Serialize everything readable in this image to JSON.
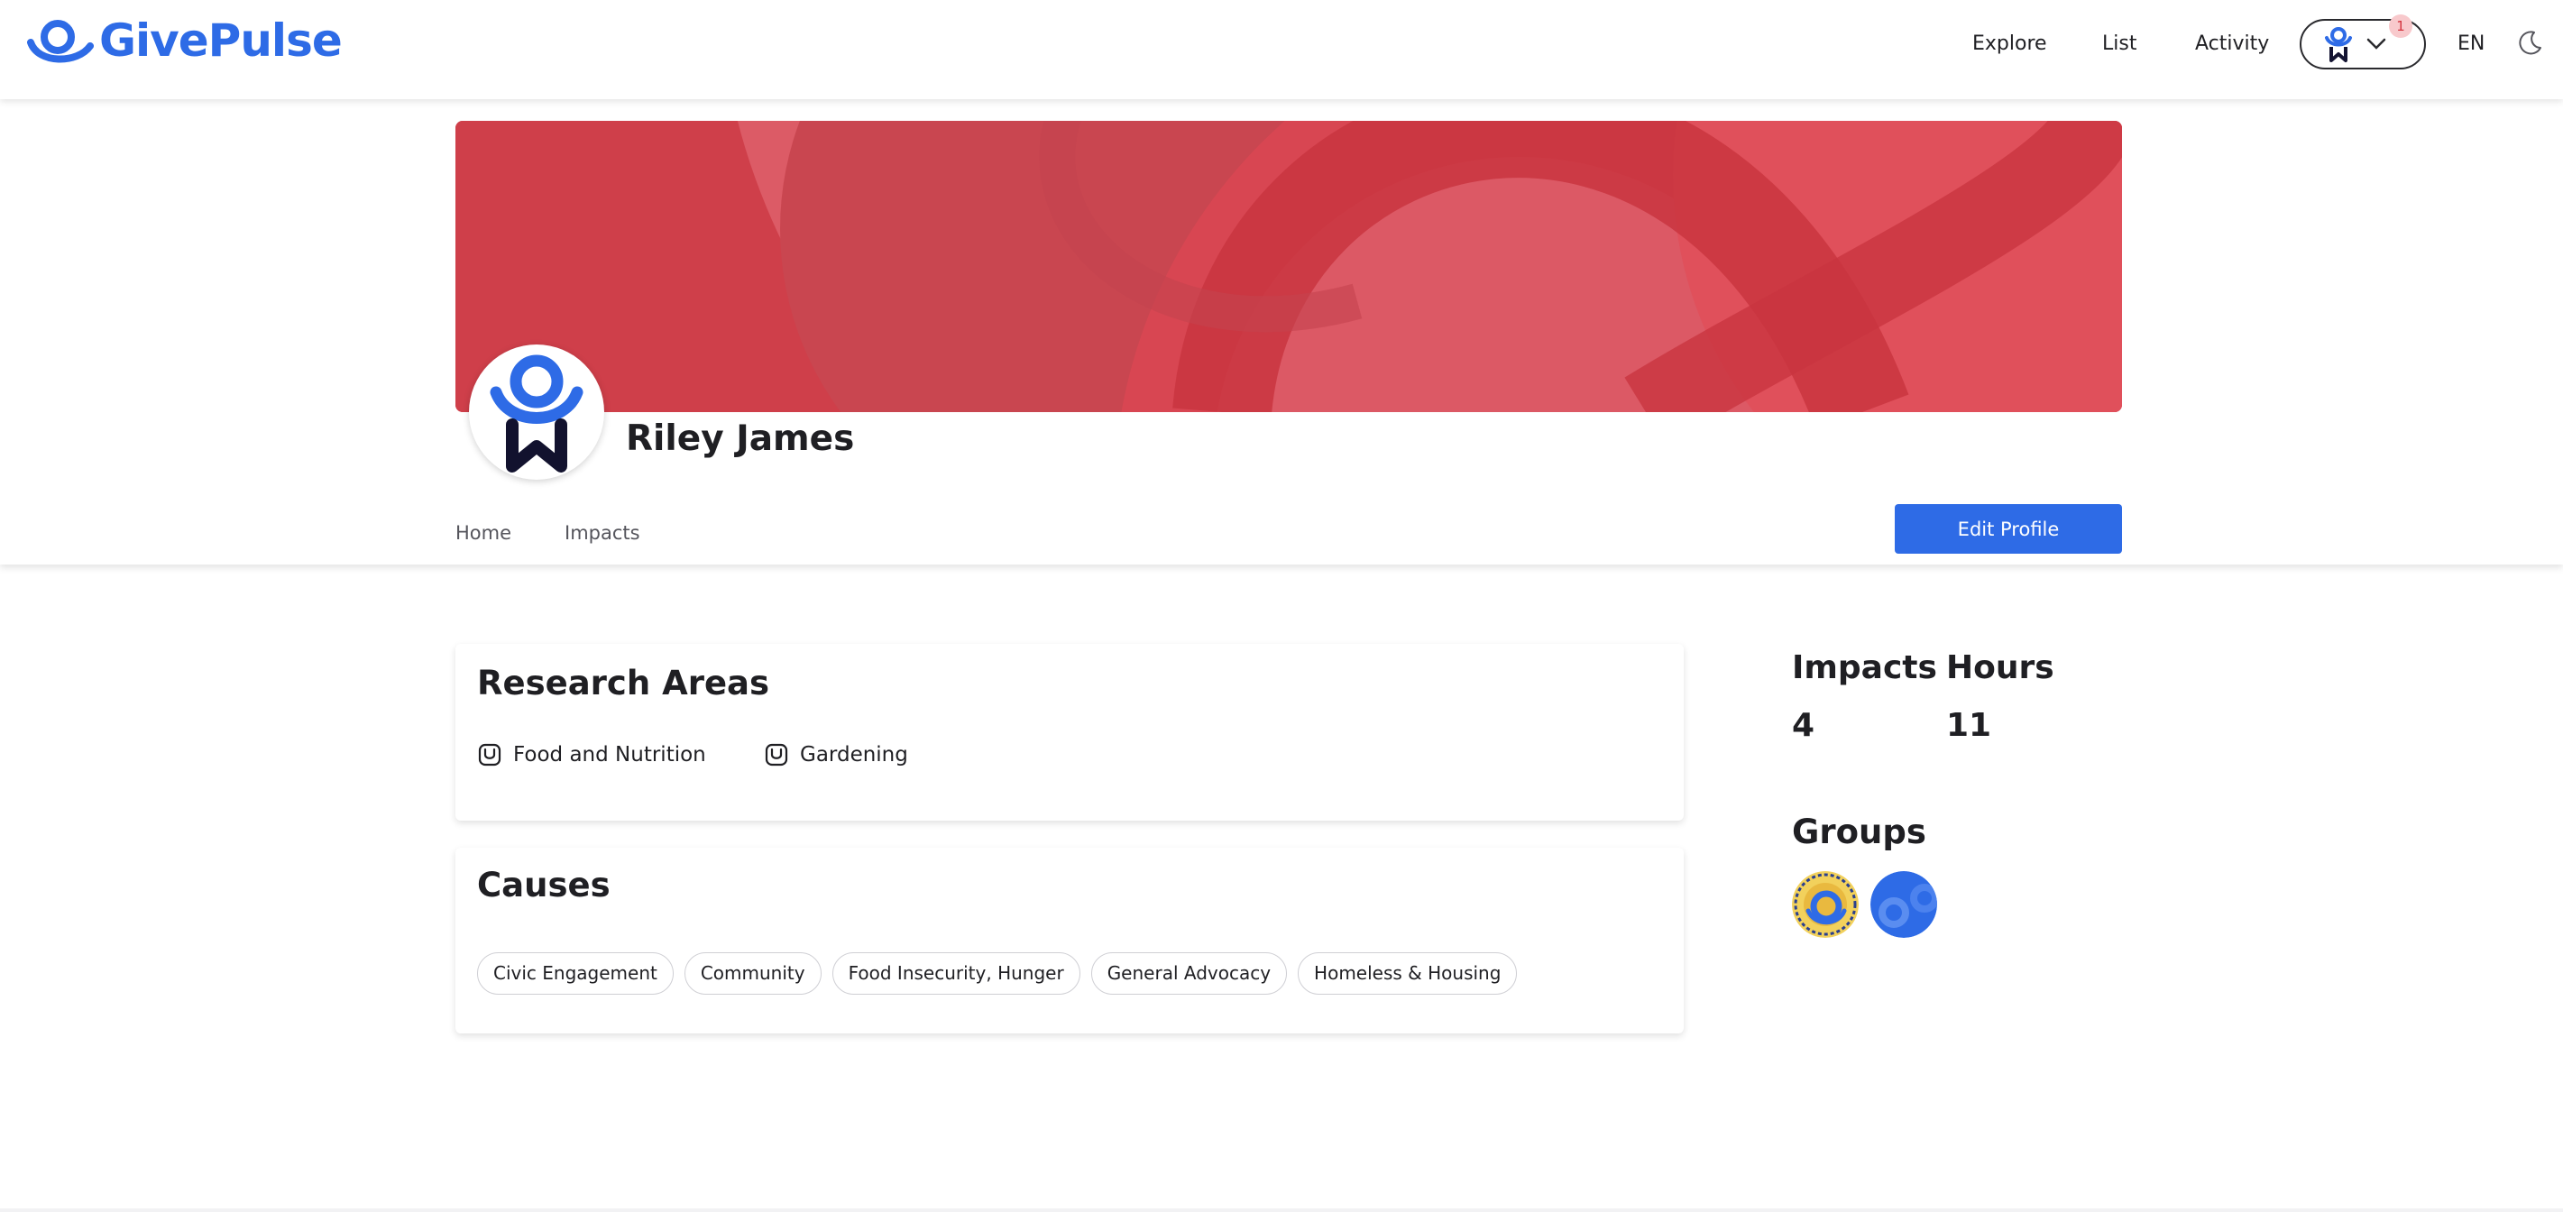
{
  "brand": {
    "name": "GivePulse",
    "color": "#2e6be6"
  },
  "topnav": {
    "links": [
      {
        "label": "Explore"
      },
      {
        "label": "List"
      },
      {
        "label": "Activity"
      }
    ],
    "notification_count": "1",
    "language": "EN",
    "theme_icon": "moon-icon"
  },
  "profile": {
    "name": "Riley James",
    "banner_color": "#d8434f",
    "tabs": [
      {
        "label": "Home"
      },
      {
        "label": "Impacts"
      }
    ],
    "edit_button": "Edit Profile"
  },
  "research_areas": {
    "title": "Research Areas",
    "items": [
      {
        "label": "Food and Nutrition"
      },
      {
        "label": "Gardening"
      }
    ]
  },
  "causes": {
    "title": "Causes",
    "items": [
      {
        "label": "Civic Engagement"
      },
      {
        "label": "Community"
      },
      {
        "label": "Food Insecurity, Hunger"
      },
      {
        "label": "General Advocacy"
      },
      {
        "label": "Homeless & Housing"
      }
    ]
  },
  "stats": {
    "impacts_label": "Impacts",
    "impacts_value": "4",
    "hours_label": "Hours",
    "hours_value": "11"
  },
  "groups": {
    "title": "Groups",
    "items": [
      {
        "icon": "group-badge-yellow"
      },
      {
        "icon": "group-badge-blue"
      }
    ]
  }
}
